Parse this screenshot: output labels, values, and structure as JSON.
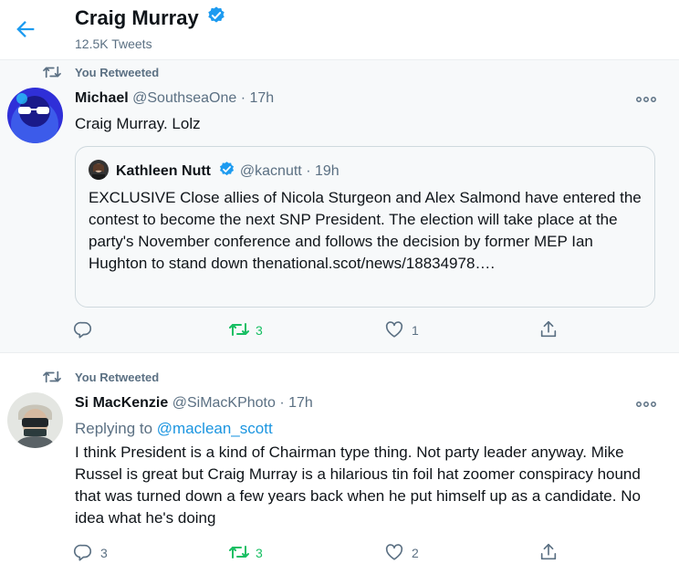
{
  "header": {
    "title": "Craig Murray",
    "tweet_count": "12.5K Tweets"
  },
  "tweets": [
    {
      "retweet_label": "You Retweeted",
      "author_name": "Michael",
      "author_handle": "@SouthseaOne",
      "time": "· 17h",
      "text": "Craig Murray. Lolz",
      "quote": {
        "author_name": "Kathleen Nutt",
        "author_handle": "@kacnutt",
        "time": "· 19h",
        "text": "EXCLUSIVE Close allies of Nicola Sturgeon and Alex Salmond have entered the contest to become the next SNP President. The election will take place at the party's November conference and follows the decision by former MEP Ian Hughton to stand down thenational.scot/news/18834978…."
      },
      "reply_count": "",
      "retweet_count": "3",
      "like_count": "1"
    },
    {
      "retweet_label": "You Retweeted",
      "author_name": "Si MacKenzie",
      "author_handle": "@SiMacKPhoto",
      "time": "· 17h",
      "replying_label": "Replying to",
      "replying_handle": "@maclean_scott",
      "text": "I think President is a kind of Chairman type thing. Not party leader anyway. Mike Russel is great but Craig Murray is a hilarious tin foil hat zoomer conspiracy hound that was turned down a few years back when he put himself up as a candidate. No idea what he's doing",
      "reply_count": "3",
      "retweet_count": "3",
      "like_count": "2"
    }
  ],
  "colors": {
    "accent": "#1d9bf0",
    "retweet_green": "#17bf63",
    "muted": "#5b7083",
    "link": "#1b95e0"
  },
  "icons": [
    "back-arrow-icon",
    "verified-badge-icon",
    "retweet-icon",
    "more-icon",
    "reply-icon",
    "like-icon",
    "share-icon"
  ]
}
